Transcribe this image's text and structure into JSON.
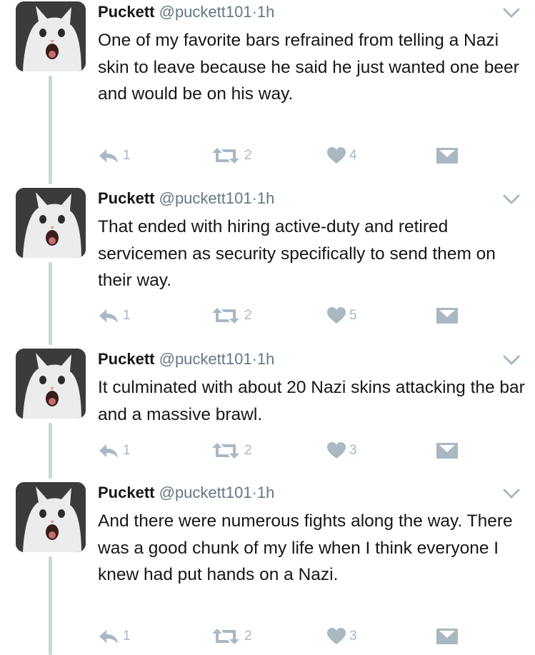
{
  "tweets": [
    {
      "name": "Puckett",
      "handle": "@puckett101",
      "separator": "·",
      "time": "1h",
      "text": "One of my favorite bars refrained from telling a Nazi skin to leave because he said he just wanted one beer and would be on his way.",
      "replies": "1",
      "retweets": "2",
      "likes": "4"
    },
    {
      "name": "Puckett",
      "handle": "@puckett101",
      "separator": "·",
      "time": "1h",
      "text": "That ended with hiring active-duty and retired servicemen as security specifically to send them on their way.",
      "replies": "1",
      "retweets": "2",
      "likes": "5"
    },
    {
      "name": "Puckett",
      "handle": "@puckett101",
      "separator": "·",
      "time": "1h",
      "text": "It culminated with about 20 Nazi skins attacking the bar and a massive brawl.",
      "replies": "1",
      "retweets": "2",
      "likes": "3"
    },
    {
      "name": "Puckett",
      "handle": "@puckett101",
      "separator": "·",
      "time": "1h",
      "text": "And there were numerous fights along the way. There was a good chunk of my life when I think everyone I knew had put hands on a Nazi.",
      "replies": "1",
      "retweets": "2",
      "likes": "3"
    }
  ],
  "icons": {
    "reply": "reply-icon",
    "retweet": "retweet-icon",
    "like": "heart-icon",
    "direct_message": "envelope-icon",
    "menu": "chevron-down-icon"
  },
  "colors": {
    "icon_gray": "#aab8c2",
    "secondary_text": "#657786",
    "thread_line": "#ccd6dd"
  }
}
